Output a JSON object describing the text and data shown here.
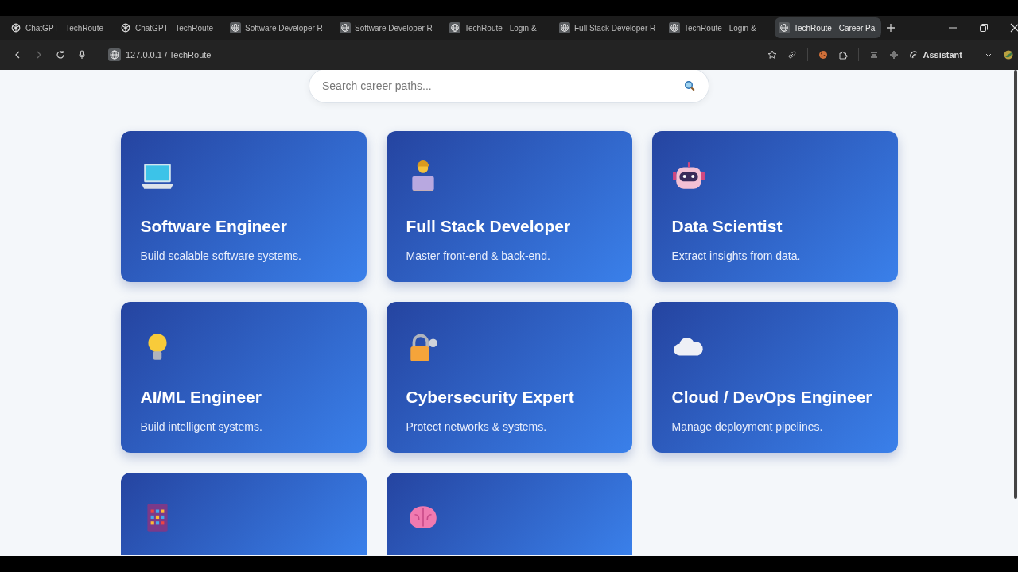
{
  "tabs": [
    {
      "kind": "chat",
      "label": "ChatGPT - TechRoute",
      "selected": false
    },
    {
      "kind": "chat",
      "label": "ChatGPT - TechRoute",
      "selected": false
    },
    {
      "kind": "web",
      "label": "Software Developer R",
      "selected": false
    },
    {
      "kind": "web",
      "label": "Software Developer R",
      "selected": false
    },
    {
      "kind": "web",
      "label": "TechRoute - Login &",
      "selected": false
    },
    {
      "kind": "web",
      "label": "Full Stack Developer R",
      "selected": false
    },
    {
      "kind": "web",
      "label": "TechRoute - Login &",
      "selected": false
    },
    {
      "kind": "web",
      "label": "TechRoute - Career Pa",
      "selected": true
    }
  ],
  "address": "127.0.0.1 / TechRoute",
  "assistant": "Assistant",
  "search": {
    "placeholder": "Search career paths..."
  },
  "cards": [
    {
      "kind": "full",
      "title": "Software Engineer",
      "description": "Build scalable software systems."
    },
    {
      "kind": "full",
      "title": "Full Stack Developer",
      "description": "Master front-end & back-end."
    },
    {
      "kind": "full",
      "title": "Data Scientist",
      "description": "Extract insights from data."
    },
    {
      "kind": "full",
      "title": "AI/ML Engineer",
      "description": "Build intelligent systems."
    },
    {
      "kind": "full",
      "title": "Cybersecurity Expert",
      "description": "Protect networks & systems."
    },
    {
      "kind": "full",
      "title": "Cloud / DevOps Engineer",
      "description": "Manage deployment pipelines."
    },
    {
      "kind": "cut"
    },
    {
      "kind": "cut"
    }
  ]
}
